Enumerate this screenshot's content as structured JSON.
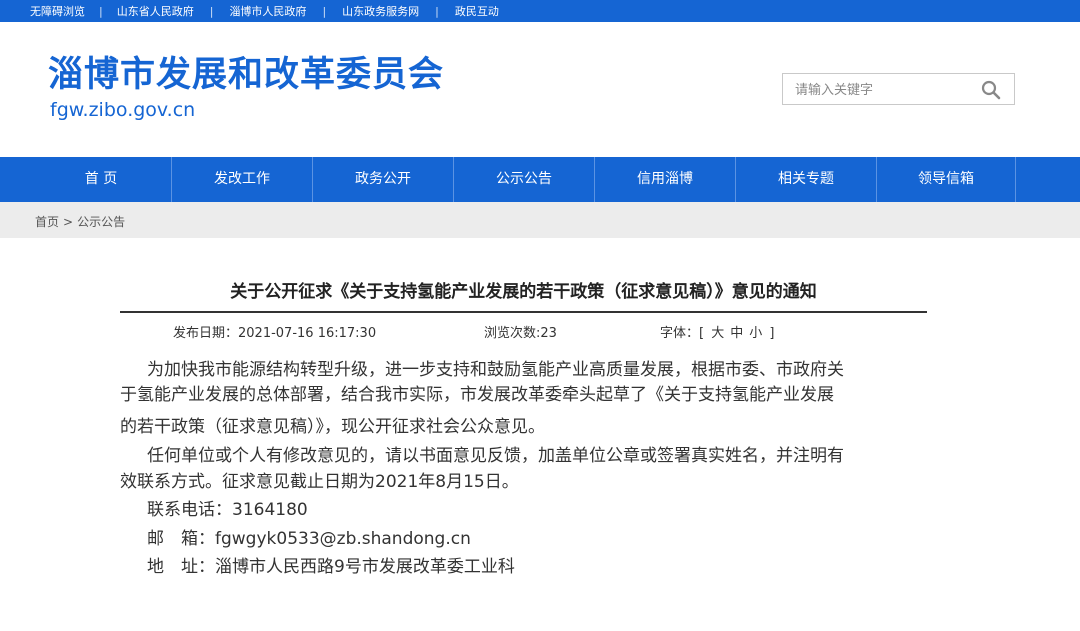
{
  "topbar": {
    "links": [
      "无障碍浏览",
      "山东省人民政府",
      "淄博市人民政府",
      "山东政务服务网",
      "政民互动"
    ]
  },
  "header": {
    "title": "淄博市发展和改革委员会",
    "url": "fgw.zibo.gov.cn"
  },
  "search": {
    "placeholder": "请输入关键字",
    "icon": "search-icon"
  },
  "nav": {
    "items": [
      "首 页",
      "发改工作",
      "政务公开",
      "公示公告",
      "信用淄博",
      "相关专题",
      "领导信箱"
    ]
  },
  "breadcrumb": {
    "home": "首页",
    "separator": ">",
    "current": "公示公告"
  },
  "article": {
    "title": "关于公开征求《关于支持氢能产业发展的若干政策（征求意见稿）》意见的通知",
    "publish_label": "发布日期：",
    "publish_date": "2021-07-16 16:17:30",
    "views_label": "浏览次数:",
    "views": "23",
    "fontsize_label": "字体：[",
    "fontsize_large": "大",
    "fontsize_medium": "中",
    "fontsize_small": "小",
    "fontsize_end": "]",
    "para1_line1": "为加快我市能源结构转型升级，进一步支持和鼓励氢能产业高质量发展，根据市委、市政府关",
    "para1_line2": "于氢能产业发展的总体部署，结合我市实际，市发展改革委牵头起草了《关于支持氢能产业发展",
    "para1_line3": "的若干政策（征求意见稿）》，现公开征求社会公众意见。",
    "para2_line1": "任何单位或个人有修改意见的，请以书面意见反馈，加盖单位公章或签署真实姓名，并注明有",
    "para2_line2": "效联系方式。征求意见截止日期为2021年8月15日。",
    "phone_label": "联系电话：",
    "phone": "3164180",
    "email_label": "邮　箱：",
    "email": "fgwgyk0533@zb.shandong.cn",
    "address_label": "地　址：",
    "address": "淄博市人民西路9号市发展改革委工业科"
  },
  "colors": {
    "brand_blue": "#1565d3",
    "crumb_bg": "#ececec"
  }
}
